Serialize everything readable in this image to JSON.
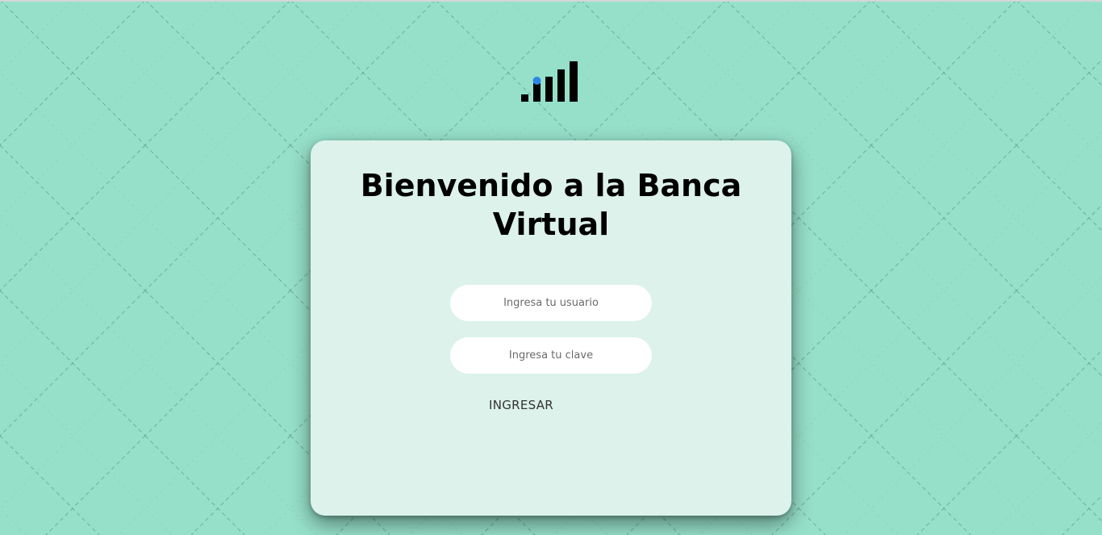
{
  "colors": {
    "background": "#96e0c9",
    "card": "#dcf2ea",
    "logo_bars": "#000000",
    "logo_dot": "#2b86e8"
  },
  "logo": {
    "icon": "signal-bars-icon"
  },
  "login": {
    "title_line1": "Bienvenido a la Banca",
    "title_line2": "Virtual",
    "username_placeholder": "Ingresa tu usuario",
    "password_placeholder": "Ingresa tu clave",
    "submit_label": "INGRESAR"
  }
}
